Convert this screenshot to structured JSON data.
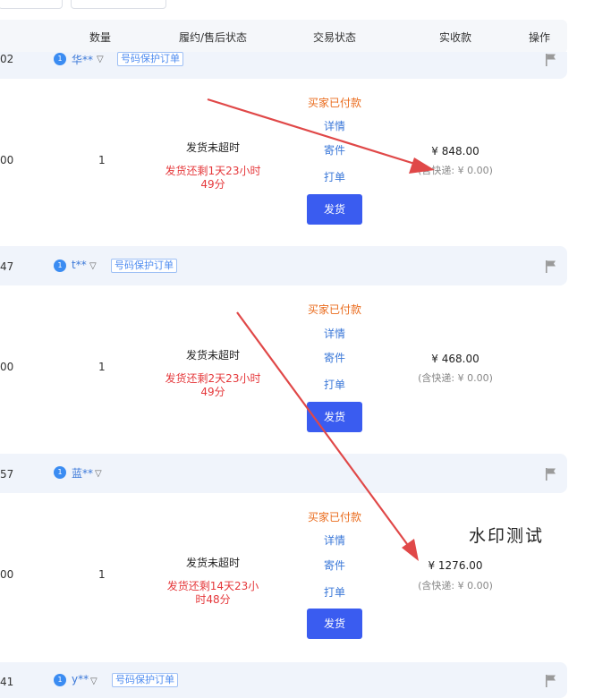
{
  "header": {
    "qty": "数量",
    "fulfillment": "履约/售后状态",
    "trade": "交易状态",
    "received": "实收款",
    "actions": "操作"
  },
  "orders": [
    {
      "id_suffix": "02",
      "buyer_initial": "1",
      "buyer": "华**",
      "tag": "号码保护订单",
      "left_value": "00",
      "qty": "1",
      "status": "发货未超时",
      "countdown_1": "发货还剩1天23小时",
      "countdown_2": "49分",
      "paid": "买家已付款",
      "detail": "详情",
      "send": "寄件",
      "print": "打单",
      "ship_btn": "发货",
      "amount": "¥ 848.00",
      "ship_fee": "(含快递: ¥ 0.00)"
    },
    {
      "id_suffix": "47",
      "buyer_initial": "1",
      "buyer": "t**",
      "tag": "号码保护订单",
      "left_value": "00",
      "qty": "1",
      "status": "发货未超时",
      "countdown_1": "发货还剩2天23小时",
      "countdown_2": "49分",
      "paid": "买家已付款",
      "detail": "详情",
      "send": "寄件",
      "print": "打单",
      "ship_btn": "发货",
      "amount": "¥ 468.00",
      "ship_fee": "(含快递: ¥ 0.00)"
    },
    {
      "id_suffix": "57",
      "buyer_initial": "1",
      "buyer": "蓝**",
      "left_value": "00",
      "qty": "1",
      "status": "发货未超时",
      "countdown_1": "发货还剩14天23小",
      "countdown_2": "时48分",
      "paid": "买家已付款",
      "detail": "详情",
      "send": "寄件",
      "print": "打单",
      "ship_btn": "发货",
      "amount": "¥ 1276.00",
      "ship_fee": "(含快递: ¥ 0.00)"
    },
    {
      "id_suffix": "41",
      "buyer_initial": "1",
      "buyer": "y**",
      "tag": "号码保护订单"
    }
  ],
  "watermark": "水印测试",
  "colors": {
    "accent": "#3a5cf0",
    "link": "#3b78d8",
    "warning": "#e5383b",
    "paid": "#ea6b1c",
    "annotation_arrow": "#e04848"
  }
}
